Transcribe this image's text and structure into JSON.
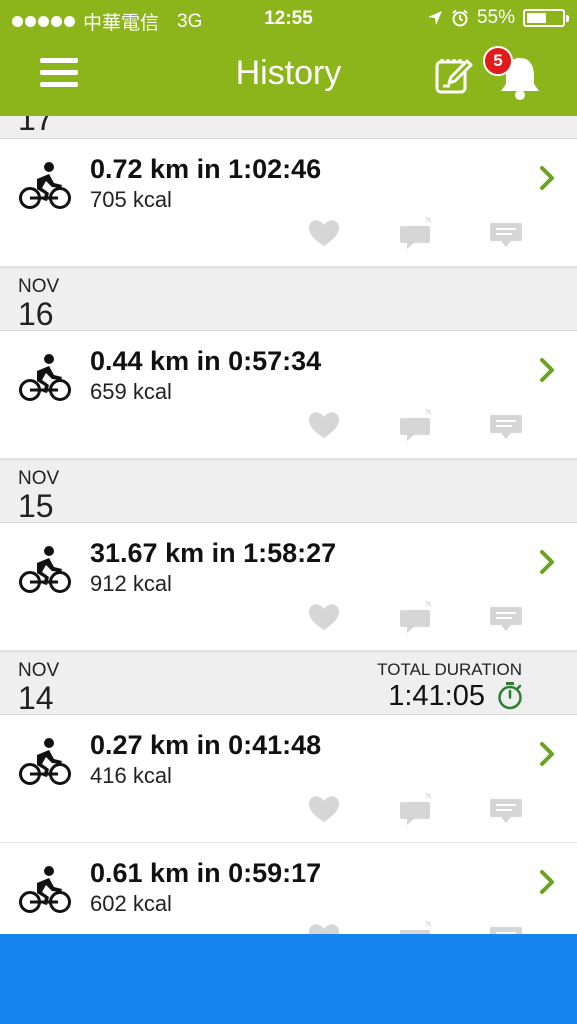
{
  "status_bar": {
    "carrier": "中華電信",
    "network": "3G",
    "time": "12:55",
    "battery": "55%",
    "battery_level": 0.55
  },
  "nav": {
    "title": "History",
    "notification_count": "5"
  },
  "colors": {
    "brand_green": "#8cb51c",
    "badge_red": "#e01b1b",
    "stopwatch_green": "#2e7d32",
    "bottom_blue": "#1683ee",
    "icon_gray": "#d6d6d6"
  },
  "icons": {
    "menu": "hamburger-menu-icon",
    "edit": "edit-note-icon",
    "bell": "bell-icon",
    "activity": "bicycle-icon",
    "open": "chevron-right-icon",
    "like": "heart-icon",
    "share": "share-icon",
    "comment": "comment-icon",
    "total_duration": "stopwatch-icon"
  },
  "history": {
    "partial_day": "17",
    "entries": [
      {
        "title": "0.72 km in 1:02:46",
        "kcal": "705 kcal"
      },
      {
        "month": "NOV",
        "day": "16"
      },
      {
        "title": "0.44 km in 0:57:34",
        "kcal": "659 kcal"
      },
      {
        "month": "NOV",
        "day": "15"
      },
      {
        "title": "31.67 km in 1:58:27",
        "kcal": "912 kcal"
      },
      {
        "month": "NOV",
        "day": "14",
        "total_label": "TOTAL DURATION",
        "total_value": "1:41:05"
      },
      {
        "title": "0.27 km in 0:41:48",
        "kcal": "416 kcal"
      },
      {
        "title": "0.61 km in 0:59:17",
        "kcal": "602 kcal"
      }
    ]
  }
}
